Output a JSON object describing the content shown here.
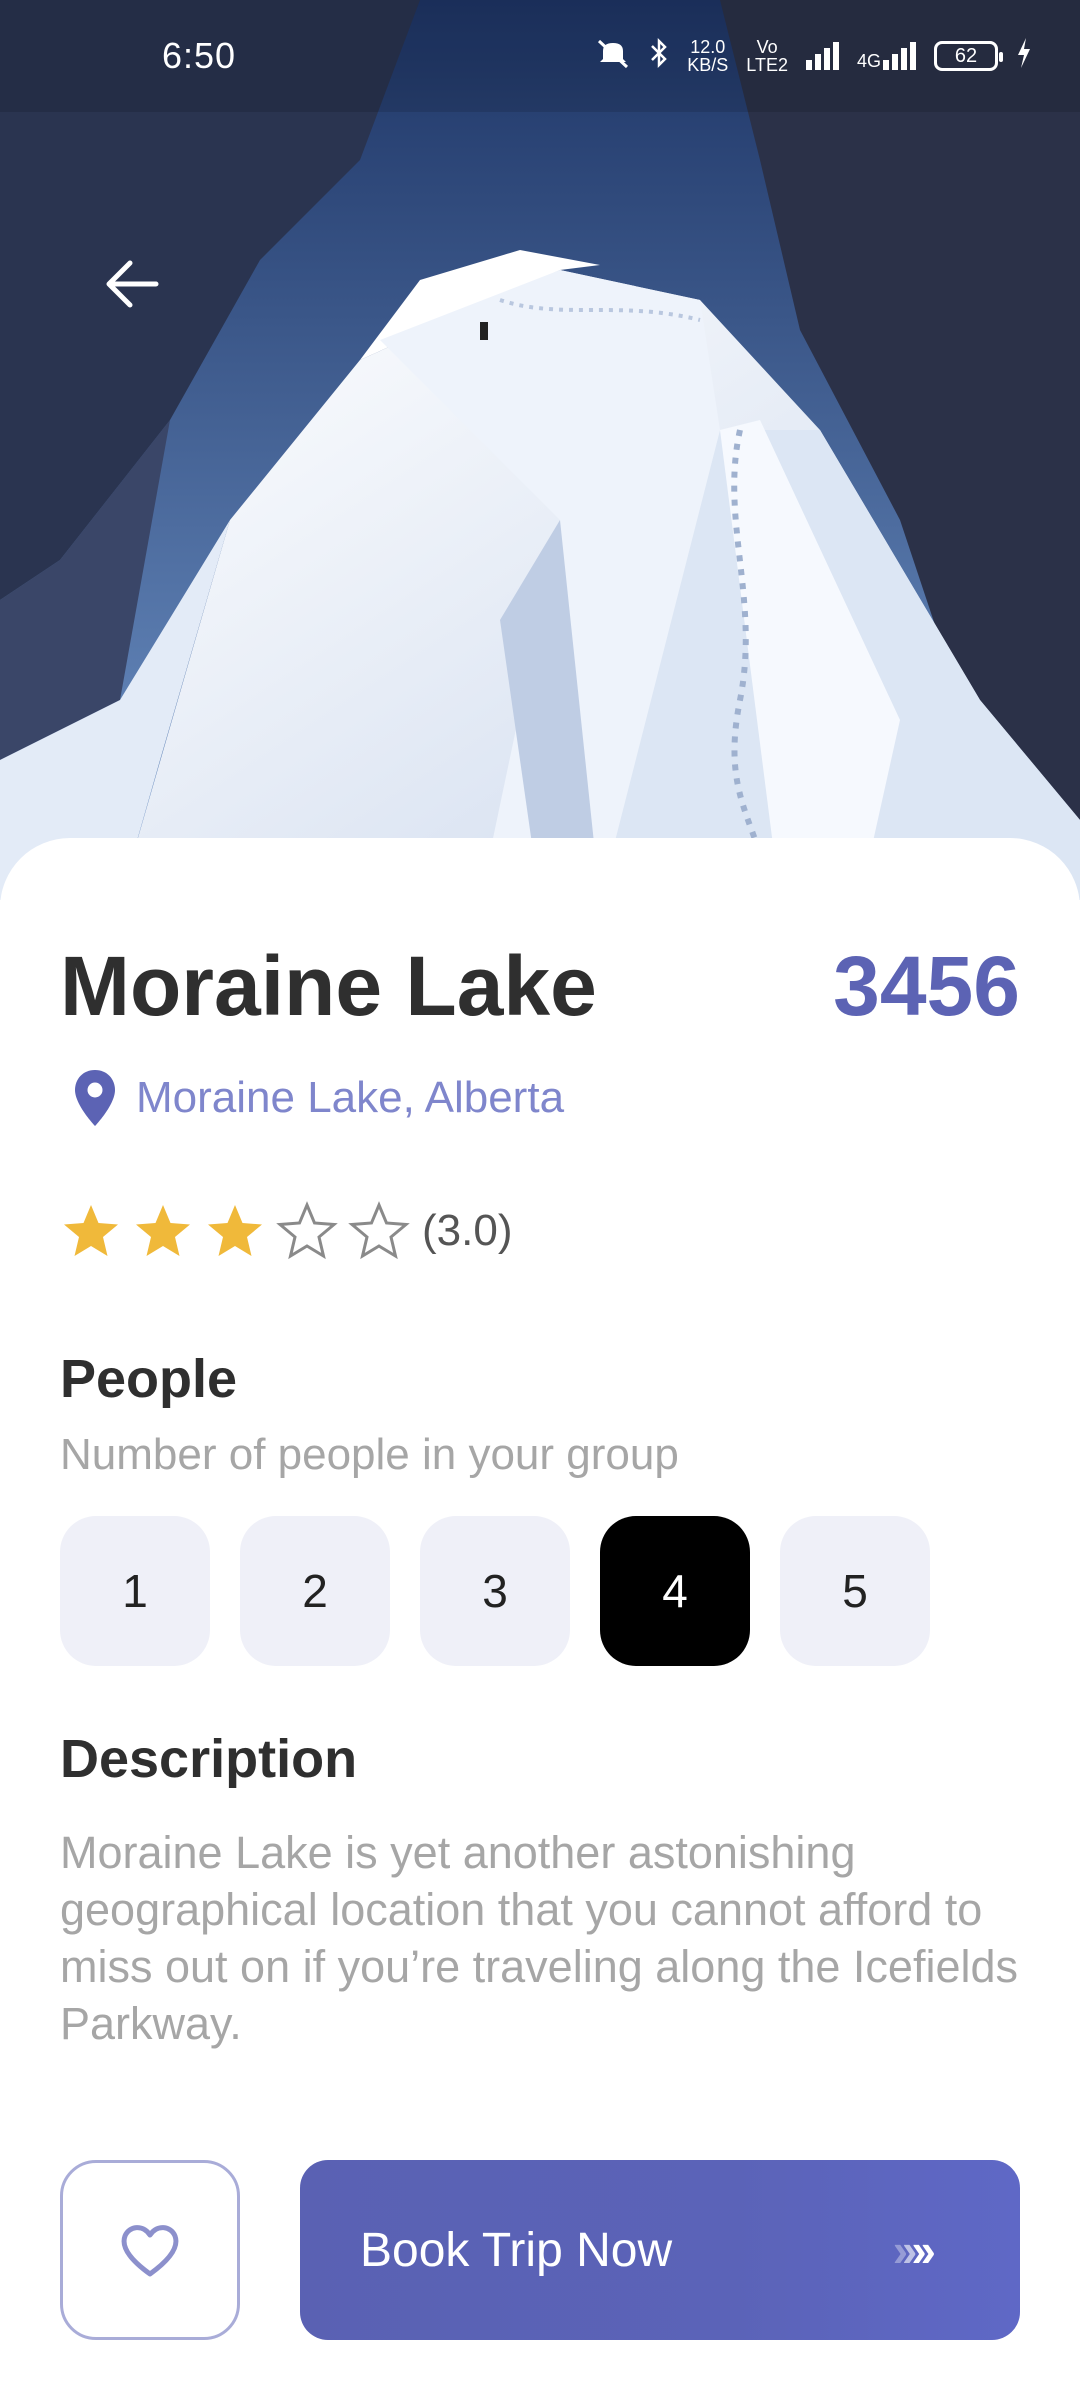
{
  "status_bar": {
    "time": "6:50",
    "net_speed_top": "12.0",
    "net_speed_bottom": "KB/S",
    "volte_top": "Vo",
    "volte_bottom": "LTE2",
    "network": "4G",
    "battery": "62"
  },
  "hero": {
    "back_icon": "arrow-left-icon"
  },
  "place": {
    "name": "Moraine Lake",
    "price": "3456",
    "location": "Moraine Lake, Alberta",
    "rating": 3,
    "rating_max": 5,
    "rating_label": "(3.0)"
  },
  "people": {
    "title": "People",
    "subtitle": "Number of people in your group",
    "options": [
      "1",
      "2",
      "3",
      "4",
      "5"
    ],
    "selected": "4"
  },
  "description": {
    "title": "Description",
    "text": "Moraine Lake is yet another astonishing geographical location that you cannot afford to miss out on if you’re traveling along the Icefields Parkway."
  },
  "actions": {
    "favorite_icon": "heart-icon",
    "book_label": "Book Trip Now",
    "book_arrows": ">>>"
  },
  "colors": {
    "accent": "#5c63b4",
    "location": "#7f86cc",
    "star": "#f0b93a",
    "selected_bg": "#000000"
  }
}
